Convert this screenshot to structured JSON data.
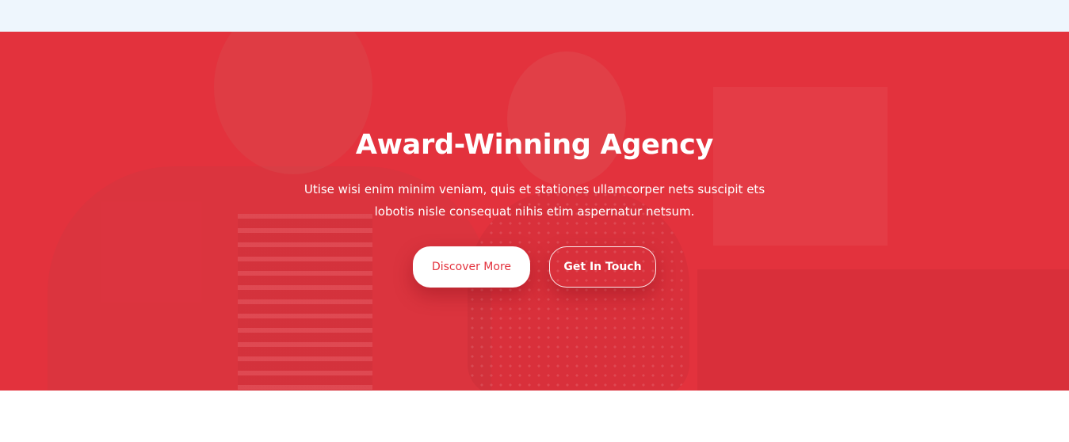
{
  "hero": {
    "title": "Award-Winning Agency",
    "description": "Utise wisi enim minim veniam, quis et stationes ullamcorper nets suscipit ets lobotis nisle consequat nihis etim aspernatur netsum.",
    "primary_button": "Discover More",
    "secondary_button": "Get In Touch"
  },
  "colors": {
    "accent": "#e3323d",
    "topbar": "#eef6fd",
    "text_on_accent": "#ffffff"
  }
}
